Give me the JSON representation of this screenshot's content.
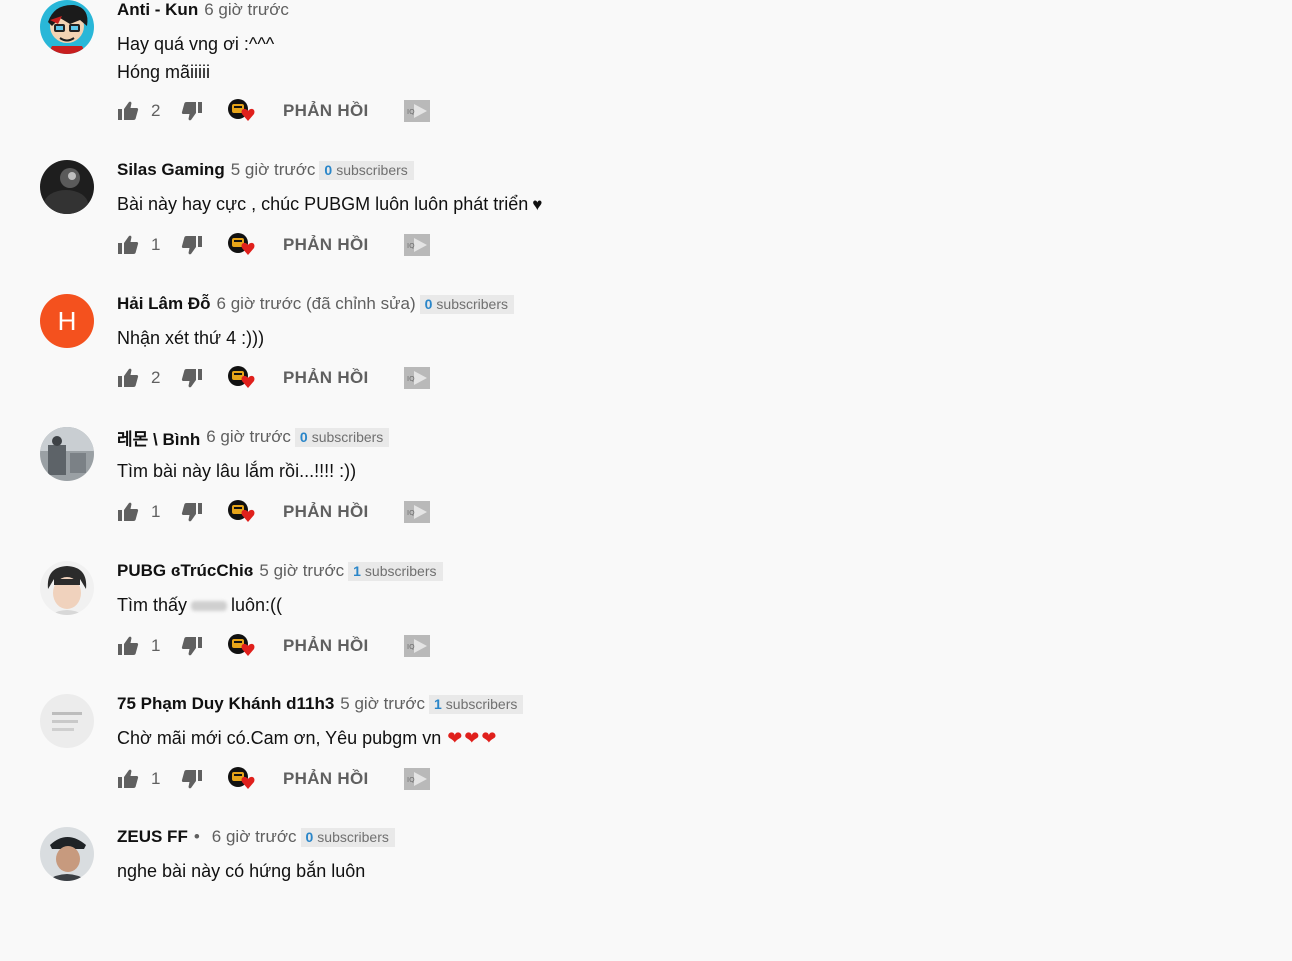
{
  "reply_label": "PHẢN HỒI",
  "subs_suffix": "subscribers",
  "comments": [
    {
      "author": "Anti - Kun",
      "time": "6 giờ trước",
      "subs": "",
      "lines": [
        "Hay quá vng ơi :^^^",
        "Hóng mãiiiii"
      ],
      "likes": "2",
      "avatar": "cartoon-avatar"
    },
    {
      "author": "Silas Gaming",
      "time": "5 giờ trước",
      "subs": "0",
      "lines": [
        "Bài này hay cực , chúc PUBGM luôn luôn phát triển"
      ],
      "likes": "1",
      "avatar": "dark-avatar"
    },
    {
      "author": "Hải Lâm Đỗ",
      "time": "6 giờ trước (đã chỉnh sửa)",
      "subs": "0",
      "lines": [
        "Nhận xét thứ 4 :)))"
      ],
      "likes": "2",
      "avatar": "letter-avatar",
      "avatar_letter": "H"
    },
    {
      "author": "레몬 \\ Bình",
      "time": "6 giờ trước",
      "subs": "0",
      "lines": [
        "Tìm bài này lâu lắm rồi...!!!! :))"
      ],
      "likes": "1",
      "avatar": "photo-avatar"
    },
    {
      "author": "PUBG ɞTrúcChiɞ",
      "time": "5 giờ trước",
      "subs": "1",
      "lines": [
        "Tìm thấy",
        "luôn:(("
      ],
      "likes": "1",
      "avatar": "portrait-avatar"
    },
    {
      "author": "75 Phạm Duy Khánh d11h3",
      "time": "5 giờ trước",
      "subs": "1",
      "lines": [
        "Chờ mãi mới có.Cam ơn, Yêu pubgm vn"
      ],
      "likes": "1",
      "avatar": "paper-avatar"
    },
    {
      "author": "ZEUS FF",
      "time": "6 giờ trước",
      "subs": "0",
      "lines": [
        "nghe bài này có hứng bắn luôn"
      ],
      "likes": "",
      "avatar": "hat-avatar"
    }
  ],
  "colors": {
    "background": "#f9f9f9",
    "author": "#111111",
    "muted": "#606060",
    "subs_number": "#2a86c9",
    "letter_avatar_bg": "#f4511e",
    "heart": "#e0201c"
  },
  "icons": {
    "like": "thumbs-up-icon",
    "dislike": "thumbs-down-icon",
    "creator_heart": "creator-heart-icon",
    "iq": "iq-extension-icon"
  }
}
